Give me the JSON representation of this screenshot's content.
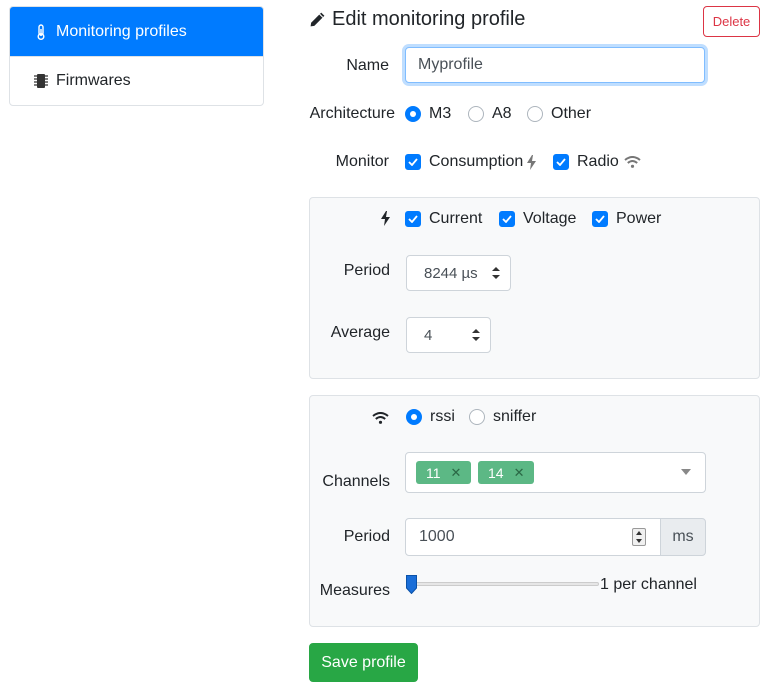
{
  "sidebar": {
    "items": [
      {
        "label": "Monitoring profiles",
        "icon": "thermometer-icon",
        "active": true
      },
      {
        "label": "Firmwares",
        "icon": "chip-icon",
        "active": false
      }
    ]
  },
  "header": {
    "title": "Edit monitoring profile",
    "delete_label": "Delete"
  },
  "form": {
    "name_label": "Name",
    "name_value": "Myprofile",
    "architecture_label": "Architecture",
    "architecture_options": [
      "M3",
      "A8",
      "Other"
    ],
    "architecture_selected": "M3",
    "monitor_label": "Monitor",
    "monitor_consumption": "Consumption",
    "monitor_radio": "Radio"
  },
  "consumption": {
    "checks": [
      "Current",
      "Voltage",
      "Power"
    ],
    "period_label": "Period",
    "period_value": "8244 µs",
    "average_label": "Average",
    "average_value": "4"
  },
  "radio": {
    "modes": [
      "rssi",
      "sniffer"
    ],
    "mode_selected": "rssi",
    "channels_label": "Channels",
    "channels": [
      "11",
      "14"
    ],
    "period_label": "Period",
    "period_value": "1000",
    "period_unit": "ms",
    "measures_label": "Measures",
    "measures_value": "1 per channel"
  },
  "save_label": "Save profile",
  "colors": {
    "primary": "#007bff",
    "danger": "#dc3545",
    "success": "#28a745",
    "tag": "#5cb885"
  }
}
